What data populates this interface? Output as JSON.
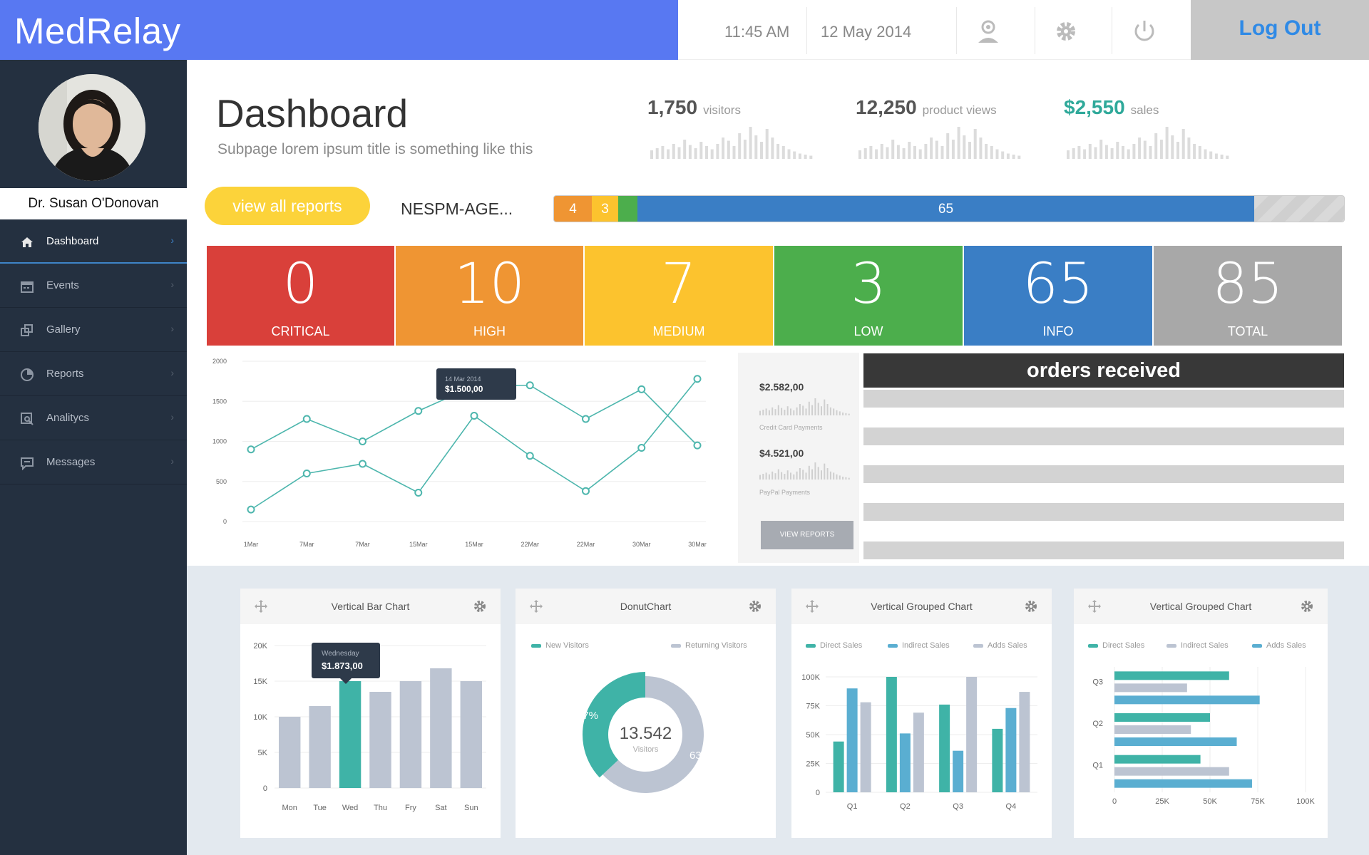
{
  "app": {
    "name": "MedRelay"
  },
  "topbar": {
    "time": "11:45 AM",
    "date": "12 May 2014",
    "logout_label": "Log Out",
    "icons": [
      "user-icon",
      "gear-icon",
      "power-icon"
    ]
  },
  "user": {
    "name": "Dr. Susan O'Donovan"
  },
  "sidebar": {
    "items": [
      {
        "label": "Dashboard",
        "icon": "home-icon",
        "active": true
      },
      {
        "label": "Events",
        "icon": "calendar-icon"
      },
      {
        "label": "Gallery",
        "icon": "gallery-icon"
      },
      {
        "label": "Reports",
        "icon": "pie-icon"
      },
      {
        "label": "Analitycs",
        "icon": "analytics-icon"
      },
      {
        "label": "Messages",
        "icon": "message-icon"
      }
    ]
  },
  "header": {
    "title": "Dashboard",
    "subtitle": "Subpage lorem ipsum title is something like this",
    "stats": [
      {
        "value": "1,750",
        "label": "visitors"
      },
      {
        "value": "12,250",
        "label": "product views"
      },
      {
        "value": "$2,550",
        "label": "sales"
      }
    ]
  },
  "actions": {
    "reports_button": "view all reports",
    "agent_label": "NESPM-AGE..."
  },
  "progress": {
    "segments": [
      "4",
      "3",
      "",
      "65"
    ],
    "colors": [
      "#ef9533",
      "#fcc32e",
      "#4cae4c",
      "#3a7ec5"
    ]
  },
  "severity": [
    {
      "value": "0",
      "label": "CRITICAL",
      "color": "#d9403a"
    },
    {
      "value": "10",
      "label": "HIGH",
      "color": "#ef9533"
    },
    {
      "value": "7",
      "label": "MEDIUM",
      "color": "#fcc32e"
    },
    {
      "value": "3",
      "label": "LOW",
      "color": "#4cae4c"
    },
    {
      "value": "65",
      "label": "INFO",
      "color": "#3a7ec5"
    },
    {
      "value": "85",
      "label": "TOTAL",
      "color": "#a8a8a8"
    }
  ],
  "line_tooltip": {
    "date": "14 Mar 2014",
    "value": "$1.500,00"
  },
  "payments": {
    "credit": {
      "amount": "$2.582,00",
      "label": "Credit Card Payments"
    },
    "paypal": {
      "amount": "$4.521,00",
      "label": "PayPal Payments"
    },
    "button": "VIEW REPORTS"
  },
  "orders": {
    "title": "orders received"
  },
  "bar_tooltip": {
    "day": "Wednesday",
    "value": "$1.873,00"
  },
  "cards": [
    {
      "title": "Vertical Bar Chart"
    },
    {
      "title": "DonutChart",
      "legend": [
        "New Visitors",
        "Returning Visitors"
      ],
      "center_value": "13.542",
      "center_label": "Visitors",
      "pct_new": "37%",
      "pct_ret": "63%"
    },
    {
      "title": "Vertical Grouped Chart",
      "legend": [
        "Direct Sales",
        "Indirect Sales",
        "Adds Sales"
      ]
    },
    {
      "title": "Vertical Grouped Chart",
      "legend": [
        "Direct Sales",
        "Indirect Sales",
        "Adds Sales"
      ]
    }
  ],
  "chart_data": [
    {
      "type": "line",
      "x": [
        "1Mar",
        "7Mar",
        "7Mar",
        "15Mar",
        "15Mar",
        "22Mar",
        "22Mar",
        "30Mar",
        "30Mar"
      ],
      "series": [
        {
          "values": [
            900,
            1280,
            1000,
            1380,
            1690,
            1700,
            1280,
            1650,
            950
          ]
        },
        {
          "values": [
            150,
            600,
            720,
            360,
            1320,
            820,
            380,
            920,
            1780
          ]
        }
      ],
      "ylim": [
        0,
        2000
      ],
      "yticks": [
        0,
        500,
        1000,
        1500,
        2000
      ],
      "grid": true
    },
    {
      "type": "bar",
      "title": "Vertical Bar Chart",
      "categories": [
        "Mon",
        "Tue",
        "Wed",
        "Thu",
        "Fry",
        "Sat",
        "Sun"
      ],
      "values": [
        10000,
        11500,
        15000,
        13500,
        15000,
        16800,
        15000
      ],
      "highlight": "Wed",
      "ylim": [
        0,
        20000
      ],
      "yticks": [
        "0",
        "5K",
        "10K",
        "15K",
        "20K"
      ]
    },
    {
      "type": "pie",
      "title": "DonutChart",
      "categories": [
        "New Visitors",
        "Returning Visitors"
      ],
      "values": [
        37,
        63
      ],
      "colors": [
        "#3fb3a7",
        "#bcc4d2"
      ]
    },
    {
      "type": "bar",
      "title": "Vertical Grouped Chart",
      "categories": [
        "Q1",
        "Q2",
        "Q3",
        "Q4"
      ],
      "series": [
        {
          "name": "Direct Sales",
          "color": "#3fb3a7",
          "values": [
            44000,
            100000,
            76000,
            55000
          ]
        },
        {
          "name": "Indirect Sales",
          "color": "#5aaed1",
          "values": [
            90000,
            51000,
            36000,
            73000
          ]
        },
        {
          "name": "Adds Sales",
          "color": "#bcc4d2",
          "values": [
            78000,
            69000,
            100000,
            87000
          ]
        }
      ],
      "ylim": [
        0,
        100000
      ],
      "yticks": [
        "0",
        "25K",
        "50K",
        "75K",
        "100K"
      ]
    },
    {
      "type": "bar",
      "orientation": "horizontal",
      "title": "Vertical Grouped Chart",
      "categories": [
        "Q1",
        "Q2",
        "Q3"
      ],
      "series": [
        {
          "name": "Direct Sales",
          "color": "#3fb3a7",
          "values": [
            45000,
            50000,
            60000
          ]
        },
        {
          "name": "Indirect Sales",
          "color": "#bcc4d2",
          "values": [
            60000,
            40000,
            38000
          ]
        },
        {
          "name": "Adds Sales",
          "color": "#5aaed1",
          "values": [
            72000,
            64000,
            76000
          ]
        }
      ],
      "xlim": [
        0,
        100000
      ],
      "xticks": [
        "0",
        "25K",
        "50K",
        "75K",
        "100K"
      ]
    }
  ]
}
